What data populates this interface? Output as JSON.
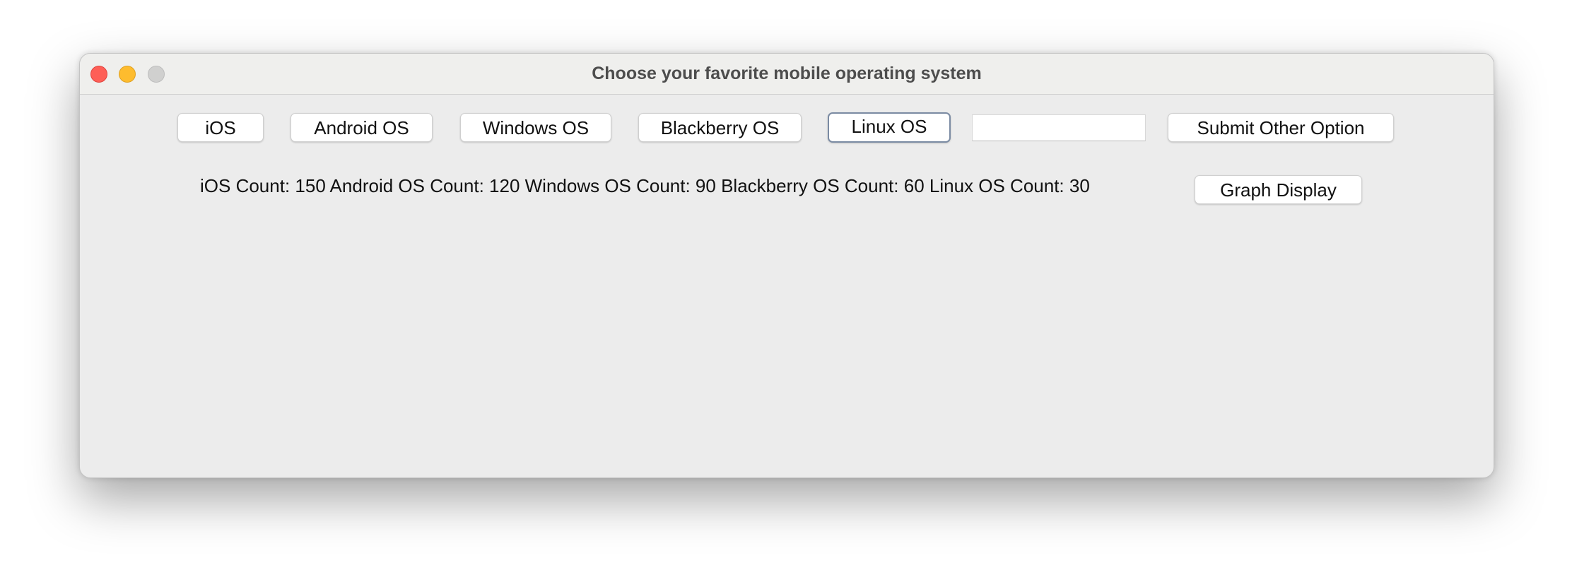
{
  "window": {
    "title": "Choose your favorite mobile operating system"
  },
  "buttons": {
    "ios": "iOS",
    "android": "Android OS",
    "windows": "Windows OS",
    "blackberry": "Blackberry OS",
    "linux": "Linux OS",
    "submit_other": "Submit Other Option",
    "graph_display": "Graph Display"
  },
  "other_option_input": {
    "value": ""
  },
  "counts_label": "iOS Count: 150 Android OS Count: 120 Windows OS Count: 90 Blackberry OS Count: 60 Linux OS Count: 30",
  "colors": {
    "close": "#fe5f57",
    "minimize": "#febc2e",
    "zoom": "#d0d0cf",
    "focus_ring": "#7b8ba3"
  }
}
